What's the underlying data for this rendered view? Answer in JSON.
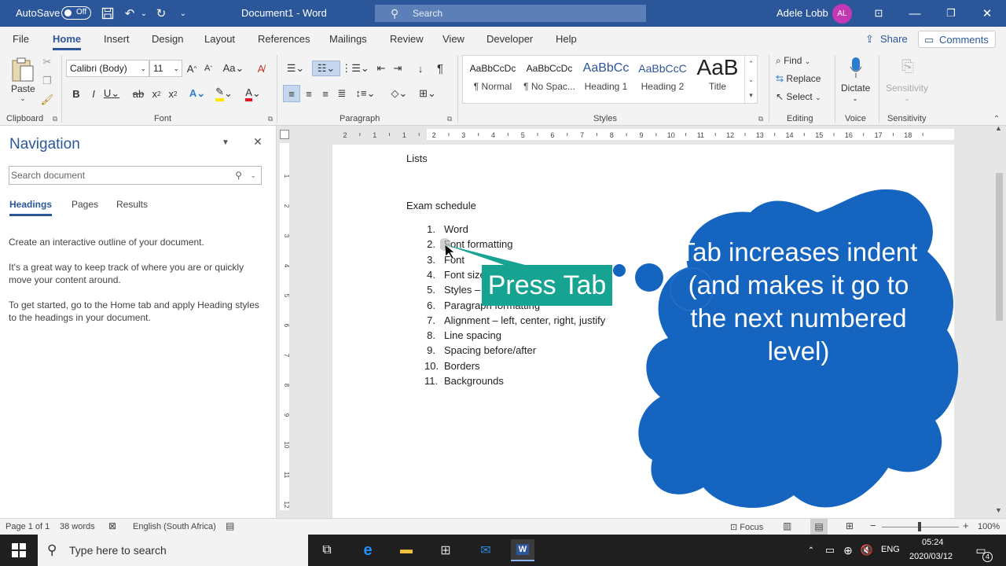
{
  "titlebar": {
    "autosave": "AutoSave",
    "toggle": "Off",
    "doc_title": "Document1  -  Word",
    "search_placeholder": "Search",
    "user": "Adele Lobb",
    "initials": "AL"
  },
  "tabs": [
    "File",
    "Home",
    "Insert",
    "Design",
    "Layout",
    "References",
    "Mailings",
    "Review",
    "View",
    "Developer",
    "Help"
  ],
  "tab_right": {
    "share": "Share",
    "comments": "Comments"
  },
  "ribbon": {
    "clipboard": {
      "paste": "Paste",
      "label": "Clipboard"
    },
    "font": {
      "name": "Calibri (Body)",
      "size": "11",
      "label": "Font"
    },
    "paragraph": {
      "label": "Paragraph"
    },
    "styles": {
      "label": "Styles",
      "items": [
        {
          "preview": "AaBbCcDc",
          "name": "¶ Normal"
        },
        {
          "preview": "AaBbCcDc",
          "name": "¶ No Spac..."
        },
        {
          "preview": "AaBbCc",
          "name": "Heading 1"
        },
        {
          "preview": "AaBbCcC",
          "name": "Heading 2"
        },
        {
          "preview": "AaB",
          "name": "Title"
        }
      ]
    },
    "editing": {
      "find": "Find",
      "replace": "Replace",
      "select": "Select",
      "label": "Editing"
    },
    "voice": {
      "dictate": "Dictate",
      "label": "Voice"
    },
    "sensitivity": {
      "name": "Sensitivity",
      "label": "Sensitivity"
    }
  },
  "navigation": {
    "title": "Navigation",
    "search_placeholder": "Search document",
    "tabs": [
      "Headings",
      "Pages",
      "Results"
    ],
    "text1": "Create an interactive outline of your document.",
    "text2": "It's a great way to keep track of where you are or quickly move your content around.",
    "text3": "To get started, go to the Home tab and apply Heading styles to the headings in your document."
  },
  "ruler": [
    "2",
    "1",
    "1",
    "2",
    "3",
    "4",
    "5",
    "6",
    "7",
    "8",
    "9",
    "10",
    "11",
    "12",
    "13",
    "14",
    "15",
    "16",
    "17",
    "18"
  ],
  "vruler": [
    "1",
    "2",
    "3",
    "4",
    "5",
    "6",
    "7",
    "8",
    "9",
    "10",
    "11",
    "12"
  ],
  "document": {
    "heading": "Lists",
    "subheading": "Exam schedule",
    "items": [
      {
        "n": "1.",
        "t": "Word"
      },
      {
        "n": "2.",
        "t": "Font formatting"
      },
      {
        "n": "3.",
        "t": "Font"
      },
      {
        "n": "4.",
        "t": "Font size"
      },
      {
        "n": "5.",
        "t": "Styles –"
      },
      {
        "n": "6.",
        "t": "Paragraph formatting"
      },
      {
        "n": "7.",
        "t": "Alignment – left, center, right, justify"
      },
      {
        "n": "8.",
        "t": "Line spacing"
      },
      {
        "n": "9.",
        "t": "Spacing before/after"
      },
      {
        "n": "10.",
        "t": "Borders"
      },
      {
        "n": "11.",
        "t": "Backgrounds"
      }
    ]
  },
  "overlay": {
    "press_tab": "Press Tab",
    "bubble": "Tab increases indent (and makes it go to the next numbered level)",
    "press_color": "#16a392",
    "bubble_color": "#1565c0"
  },
  "status": {
    "page": "Page 1 of 1",
    "words": "38 words",
    "language": "English (South Africa)",
    "focus": "Focus",
    "zoom": "100%"
  },
  "taskbar": {
    "search": "Type here to search",
    "lang": "ENG",
    "time": "05:24",
    "date": "2020/03/12",
    "notif": "4"
  }
}
